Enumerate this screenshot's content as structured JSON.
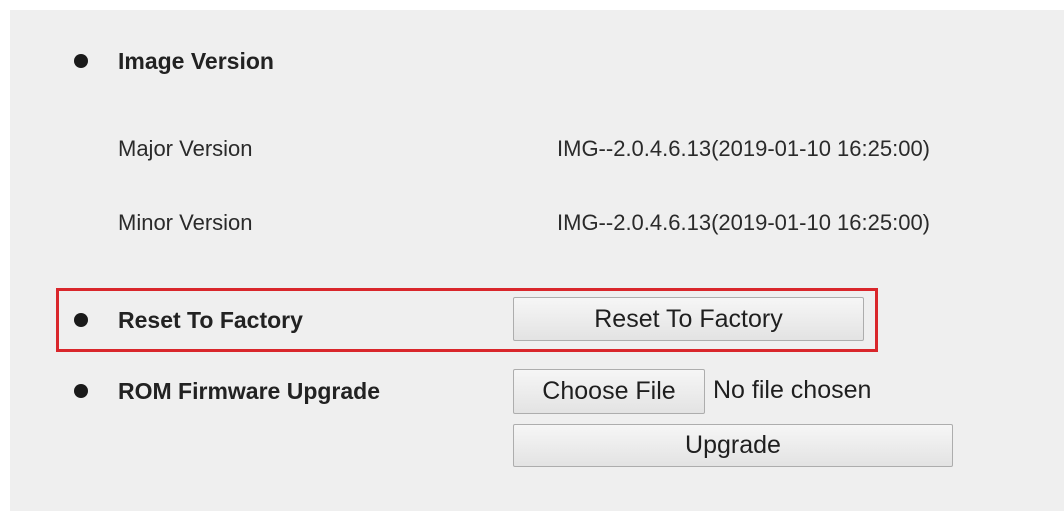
{
  "image_version": {
    "title": "Image Version",
    "major_label": "Major Version",
    "major_value": "IMG--2.0.4.6.13(2019-01-10 16:25:00)",
    "minor_label": "Minor Version",
    "minor_value": "IMG--2.0.4.6.13(2019-01-10 16:25:00)"
  },
  "reset": {
    "title": "Reset To Factory",
    "button_label": "Reset To Factory",
    "highlight_color": "#d9262b"
  },
  "firmware": {
    "title": "ROM Firmware Upgrade",
    "choose_file_label": "Choose File",
    "no_file_text": "No file chosen",
    "upgrade_label": "Upgrade"
  },
  "colors": {
    "panel_background": "#efefef",
    "text": "#222222"
  },
  "icons": {
    "bullet": "bullet-icon"
  }
}
